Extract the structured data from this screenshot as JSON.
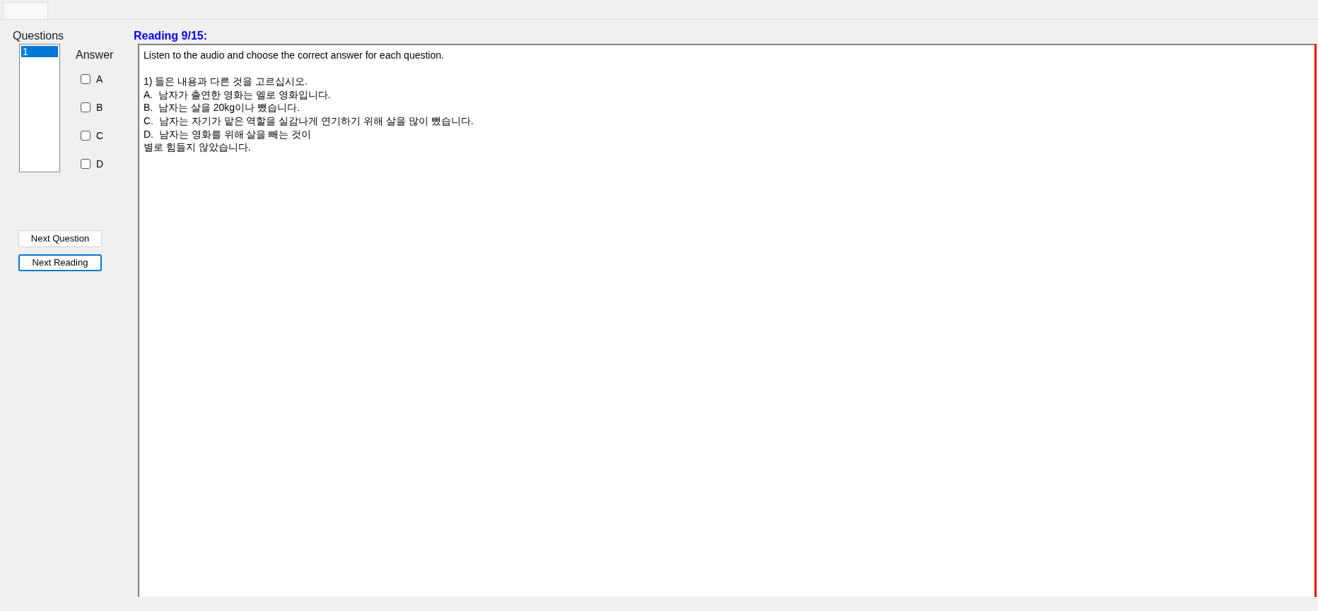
{
  "questions": {
    "label": "Questions",
    "items": [
      {
        "label": "1",
        "selected": true
      }
    ]
  },
  "answer": {
    "label": "Answer",
    "options": [
      {
        "label": "A",
        "checked": false
      },
      {
        "label": "B",
        "checked": false
      },
      {
        "label": "C",
        "checked": false
      },
      {
        "label": "D",
        "checked": false
      }
    ]
  },
  "buttons": [
    {
      "label": "Next Question",
      "focused": false
    },
    {
      "label": "Next Reading",
      "focused": true
    }
  ],
  "reading": {
    "title": "Reading 9/15:",
    "instruction": "Listen to the audio and choose the correct answer for each question.",
    "lines": [
      "1) 들은 내용과 다른 것을 고르십시오.",
      "A.  남자가 출연한 영화는 멜로 영화입니다.",
      "B.  남자는 살을 20kg이나 뺐습니다.",
      "C.  남자는 자기가 맡은 역할을 실감나게 연기하기 위해 살을 많이 뺐습니다.",
      "D.  남자는 영화를 위해 살을 빼는 것이",
      "별로 힘들지 않았습니다."
    ]
  }
}
